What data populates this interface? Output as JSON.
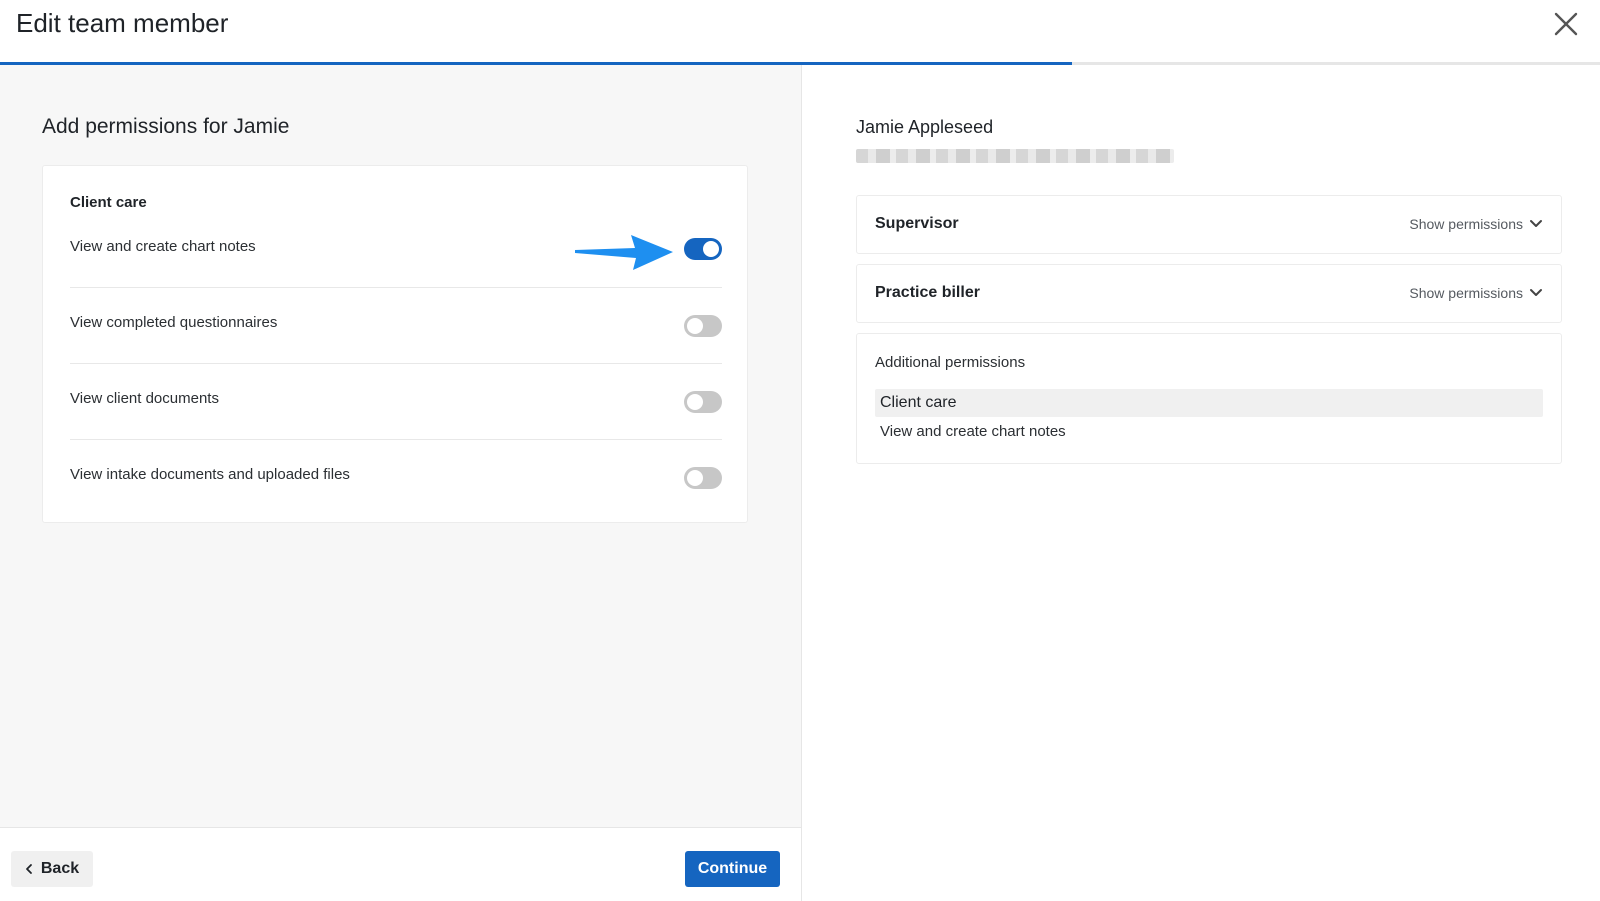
{
  "header": {
    "title": "Edit team member",
    "progress_percent": 67
  },
  "left": {
    "section_title": "Add permissions for Jamie",
    "group_title": "Client care",
    "permissions": [
      {
        "label": "View and create chart notes",
        "enabled": true
      },
      {
        "label": "View completed questionnaires",
        "enabled": false
      },
      {
        "label": "View client documents",
        "enabled": false
      },
      {
        "label": "View intake documents and uploaded files",
        "enabled": false
      }
    ]
  },
  "footer": {
    "back_label": "Back",
    "continue_label": "Continue"
  },
  "right": {
    "member_name": "Jamie Appleseed",
    "roles": [
      {
        "name": "Supervisor",
        "action": "Show permissions"
      },
      {
        "name": "Practice biller",
        "action": "Show permissions"
      }
    ],
    "additional": {
      "title": "Additional permissions",
      "group": "Client care",
      "items": [
        "View and create chart notes"
      ]
    }
  },
  "colors": {
    "accent": "#1565c0",
    "annotation_arrow": "#1e8ff0",
    "toggle_off": "#c7c7c7"
  }
}
